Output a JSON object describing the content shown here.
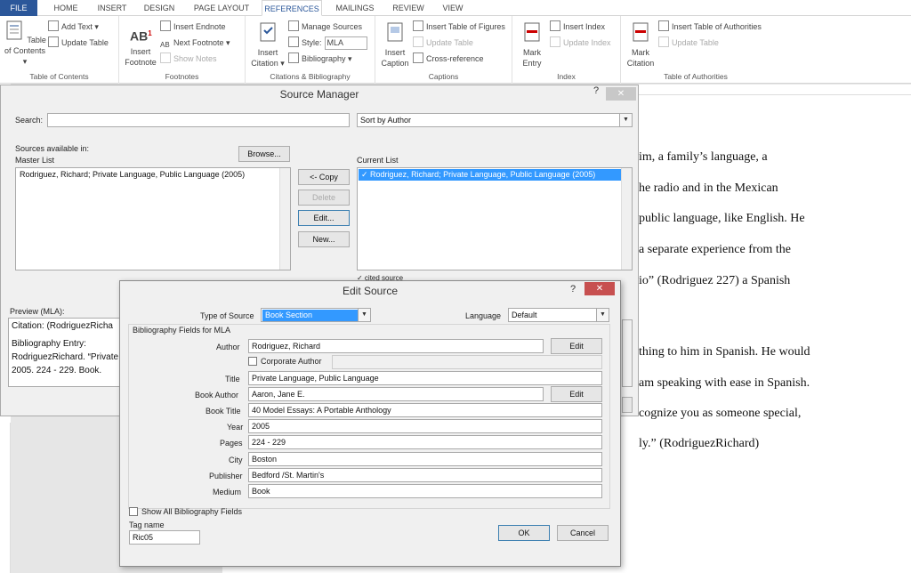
{
  "ribbon_tabs": [
    "FILE",
    "HOME",
    "INSERT",
    "DESIGN",
    "PAGE LAYOUT",
    "REFERENCES",
    "MAILINGS",
    "REVIEW",
    "VIEW"
  ],
  "ribbon": {
    "toc": {
      "big": "Table of Contents",
      "add_text": "Add Text",
      "update": "Update Table",
      "group": "Table of Contents"
    },
    "footnotes": {
      "big": "Insert Footnote",
      "endnote": "Insert Endnote",
      "next": "Next Footnote",
      "show": "Show Notes",
      "group": "Footnotes"
    },
    "citations": {
      "big": "Insert Citation",
      "manage": "Manage Sources",
      "style_label": "Style:",
      "style": "MLA",
      "bib": "Bibliography",
      "group": "Citations & Bibliography"
    },
    "captions": {
      "big": "Insert Caption",
      "tof": "Insert Table of Figures",
      "update": "Update Table",
      "xref": "Cross-reference",
      "group": "Captions"
    },
    "index": {
      "big": "Mark Entry",
      "insert": "Insert Index",
      "update": "Update Index",
      "group": "Index"
    },
    "toa": {
      "big": "Mark Citation",
      "insert": "Insert Table of Authorities",
      "update": "Update Table",
      "group": "Table of Authorities"
    }
  },
  "document_lines": [
    "im, a family’s language, a",
    "he radio and in the Mexican",
    " public language, like English. He",
    "a separate experience from the",
    "io” (Rodriguez 227) a Spanish",
    "thing to him in Spanish. He would",
    " am speaking with ease in Spanish.",
    "cognize you as someone special,",
    "ly.” (RodriguezRichard)"
  ],
  "source_manager": {
    "title": "Source Manager",
    "help": "?",
    "close": "✕",
    "search_label": "Search:",
    "search_value": "",
    "sort": "Sort by Author",
    "sources_in": "Sources available in:",
    "master_list": "Master List",
    "browse": "Browse...",
    "master_item": "Rodriguez, Richard; Private Language, Public Language (2005)",
    "copy": "<- Copy",
    "delete": "Delete",
    "edit": "Edit...",
    "new": "New...",
    "current_list": "Current List",
    "current_item": "✓ Rodriguez, Richard; Private Language, Public Language (2005)",
    "cited": "✓ cited source",
    "preview_label": "Preview (MLA):",
    "preview_citation": "Citation:  (RodriguezRicha",
    "preview_bib_label": "Bibliography Entry:",
    "preview_bib": "RodriguezRichard. “Private",
    "preview_more": "2005. 224 - 229. Book."
  },
  "edit_source": {
    "title": "Edit Source",
    "help": "?",
    "close": "✕",
    "type_label": "Type of Source",
    "type_value": "Book Section",
    "language_label": "Language",
    "language_value": "Default",
    "fields_title": "Bibliography Fields for MLA",
    "author_label": "Author",
    "author": "Rodriguez, Richard",
    "edit_btn": "Edit",
    "corporate_label": "Corporate Author",
    "title_label": "Title",
    "title_value": "Private Language, Public Language",
    "book_author_label": "Book Author",
    "book_author": "Aaron, Jane E.",
    "book_title_label": "Book Title",
    "book_title": "40 Model Essays: A Portable Anthology",
    "year_label": "Year",
    "year": "2005",
    "pages_label": "Pages",
    "pages": "224 - 229",
    "city_label": "City",
    "city": "Boston",
    "publisher_label": "Publisher",
    "publisher": "Bedford /St. Martin's",
    "medium_label": "Medium",
    "medium": "Book",
    "show_all": "Show All Bibliography Fields",
    "tag_label": "Tag name",
    "tag": "Ric05",
    "ok": "OK",
    "cancel": "Cancel"
  },
  "colors": {
    "file_tab": "#2b579a",
    "selection": "#3399ff",
    "close_red": "#c75050"
  }
}
